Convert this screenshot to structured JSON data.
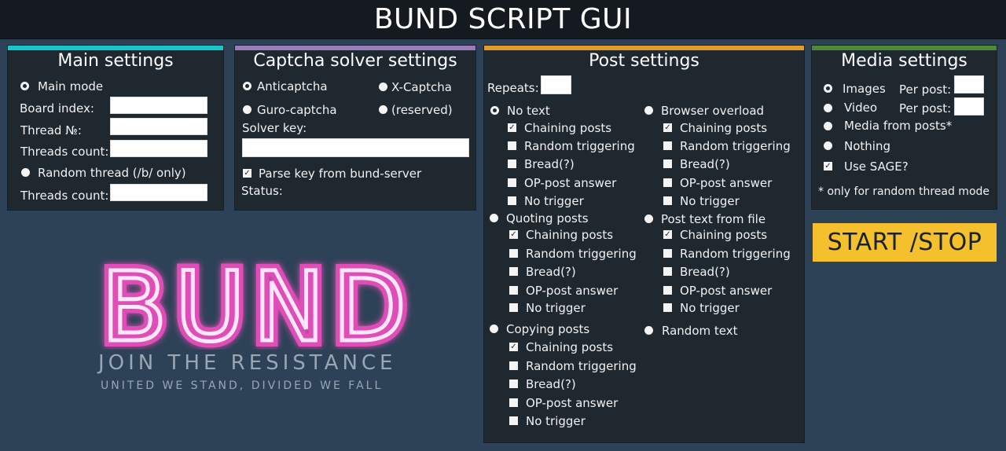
{
  "app": {
    "title": "BUND SCRIPT GUI"
  },
  "colors": {
    "main_accent": "#16c7c9",
    "captcha_accent": "#9b7bb8",
    "post_accent": "#e29a2a",
    "media_accent": "#4f8a3a",
    "start_button": "#f4c02e",
    "logo_pink": "#ff4fc8"
  },
  "main": {
    "title": "Main settings",
    "main_mode": "Main mode",
    "board_index": "Board index:",
    "thread_no": "Thread №:",
    "threads_count": "Threads count:",
    "random_thread": "Random thread (/b/ only)",
    "threads_count_2": "Threads count:"
  },
  "captcha": {
    "title": "Captcha solver settings",
    "anticaptcha": "Anticaptcha",
    "xcaptcha": "X-Captcha",
    "guro": "Guro-captcha",
    "reserved": "(reserved)",
    "solver_key": "Solver key:",
    "parse_key": "Parse key from bund-server",
    "status": "Status:"
  },
  "post": {
    "title": "Post settings",
    "repeats": "Repeats:",
    "options": [
      "Chaining posts",
      "Random triggering",
      "Bread(?)",
      "OP-post answer",
      "No trigger"
    ],
    "modes": {
      "no_text": "No text",
      "quoting": "Quoting posts",
      "copying": "Copying posts",
      "browser_overload": "Browser overload",
      "from_file": "Post text from file",
      "random_text": "Random text"
    }
  },
  "media": {
    "title": "Media settings",
    "images": "Images",
    "video": "Video",
    "per_post": "Per post:",
    "from_posts": "Media from posts*",
    "nothing": "Nothing",
    "sage": "Use SAGE?",
    "note": "* only for random thread mode"
  },
  "start_label": "START /STOP",
  "logo": {
    "word": "BUND",
    "tagline": "JOIN THE RESISTANCE",
    "subtagline": "UNITED WE STAND, DIVIDED WE FALL"
  }
}
